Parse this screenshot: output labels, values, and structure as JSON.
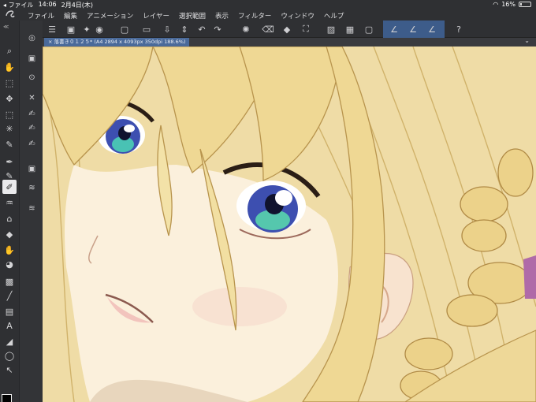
{
  "status": {
    "time": "14:06",
    "date": "2月4日(木)",
    "battery": "16%",
    "battery_level": 0.16
  },
  "menu": [
    "ファイル",
    "編集",
    "アニメーション",
    "レイヤー",
    "選択範囲",
    "表示",
    "フィルター",
    "ウィンドウ",
    "ヘルプ"
  ],
  "document": {
    "tab_label": "落書き０１２５* (A4 2894 x 4093px 350dpi 188.6%)"
  },
  "colors": {
    "main": "#000000",
    "sub": "#e45b62",
    "accent": "#3d5c8a"
  },
  "toolbar_icons": [
    "zoom-icon",
    "hand-icon",
    "rotate-icon",
    "move-icon",
    "select-layer-icon",
    "wand-icon",
    "eyedropper-icon",
    "pen-icon",
    "pencil-icon",
    "brush-icon",
    "airbrush-icon",
    "decoration-icon",
    "eraser-icon",
    "blend-icon",
    "fill-icon",
    "gradient-icon",
    "figure-icon",
    "frame-icon",
    "text-icon",
    "balloon-icon",
    "lasso-icon",
    "correct-line-icon"
  ],
  "command_icons": [
    "menu-icon",
    "new-icon",
    "open-icon",
    "save-icon",
    "undo-icon",
    "redo-icon",
    "transform-icon",
    "stabilizer-icon"
  ]
}
